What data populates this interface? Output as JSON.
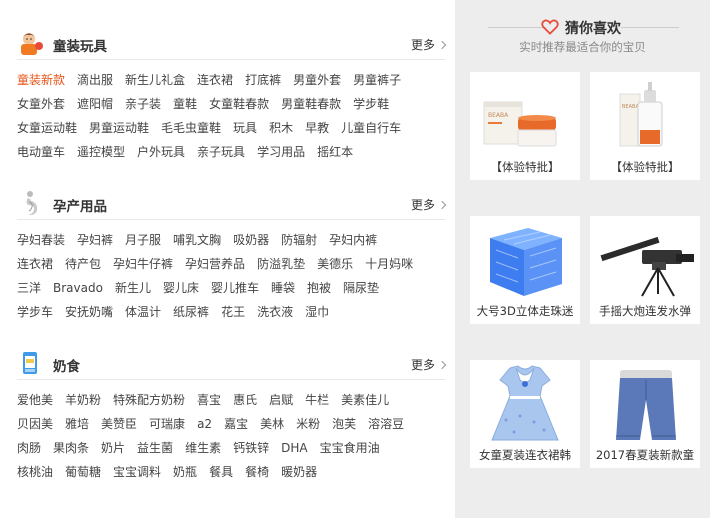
{
  "sections": [
    {
      "title": "童装玩具",
      "icon": "kid-icon",
      "more": "更多",
      "tags": [
        "童装新款",
        "滴出服",
        "新生儿礼盒",
        "连衣裙",
        "打底裤",
        "男童外套",
        "男童裤子",
        "女童外套",
        "遮阳帽",
        "亲子装",
        "童鞋",
        "女童鞋春款",
        "男童鞋春款",
        "学步鞋",
        "女童运动鞋",
        "男童运动鞋",
        "毛毛虫童鞋",
        "玩具",
        "积木",
        "早教",
        "儿童自行车",
        "电动童车",
        "遥控模型",
        "户外玩具",
        "亲子玩具",
        "学习用品",
        "摇红本"
      ]
    },
    {
      "title": "孕产用品",
      "icon": "pregnant-icon",
      "more": "更多",
      "tags": [
        "孕妇春装",
        "孕妇裤",
        "月子服",
        "哺乳文胸",
        "吸奶器",
        "防辐射",
        "孕妇内裤",
        "连衣裙",
        "待产包",
        "孕妇牛仔裤",
        "孕妇营养品",
        "防溢乳垫",
        "美德乐",
        "十月妈咪",
        "三洋",
        "Bravado",
        "新生儿",
        "婴儿床",
        "婴儿推车",
        "睡袋",
        "抱被",
        "隔尿垫",
        "学步车",
        "安抚奶嘴",
        "体温计",
        "纸尿裤",
        "花王",
        "洗衣液",
        "湿巾"
      ]
    },
    {
      "title": "奶食",
      "icon": "milk-icon",
      "more": "更多",
      "tags": [
        "爱他美",
        "羊奶粉",
        "特殊配方奶粉",
        "喜宝",
        "惠氏",
        "启赋",
        "牛栏",
        "美素佳儿",
        "贝因美",
        "雅培",
        "美赞臣",
        "可瑞康",
        "a2",
        "嘉宝",
        "美林",
        "米粉",
        "泡芙",
        "溶溶豆",
        "肉肠",
        "果肉条",
        "奶片",
        "益生菌",
        "维生素",
        "钙铁锌",
        "DHA",
        "宝宝食用油",
        "核桃油",
        "葡萄糖",
        "宝宝调料",
        "奶瓶",
        "餐具",
        "餐椅",
        "暖奶器"
      ]
    }
  ],
  "guess": {
    "title": "猜你喜欢",
    "subtitle": "实时推荐最适合你的宝贝",
    "items": [
      {
        "caption": "【体验特批】",
        "image": "cream-jar-image"
      },
      {
        "caption": "【体验特批】",
        "image": "lotion-bottle-image"
      },
      {
        "caption": "大号3D立体走珠迷",
        "image": "maze-cube-image"
      },
      {
        "caption": "手摇大炮连发水弹",
        "image": "toy-gun-image"
      },
      {
        "caption": "女童夏装连衣裙韩",
        "image": "girl-dress-image"
      },
      {
        "caption": "2017春夏装新款童",
        "image": "kids-jeans-image"
      }
    ]
  },
  "colors": {
    "accent": "#e8551a",
    "panel": "#ededed"
  }
}
